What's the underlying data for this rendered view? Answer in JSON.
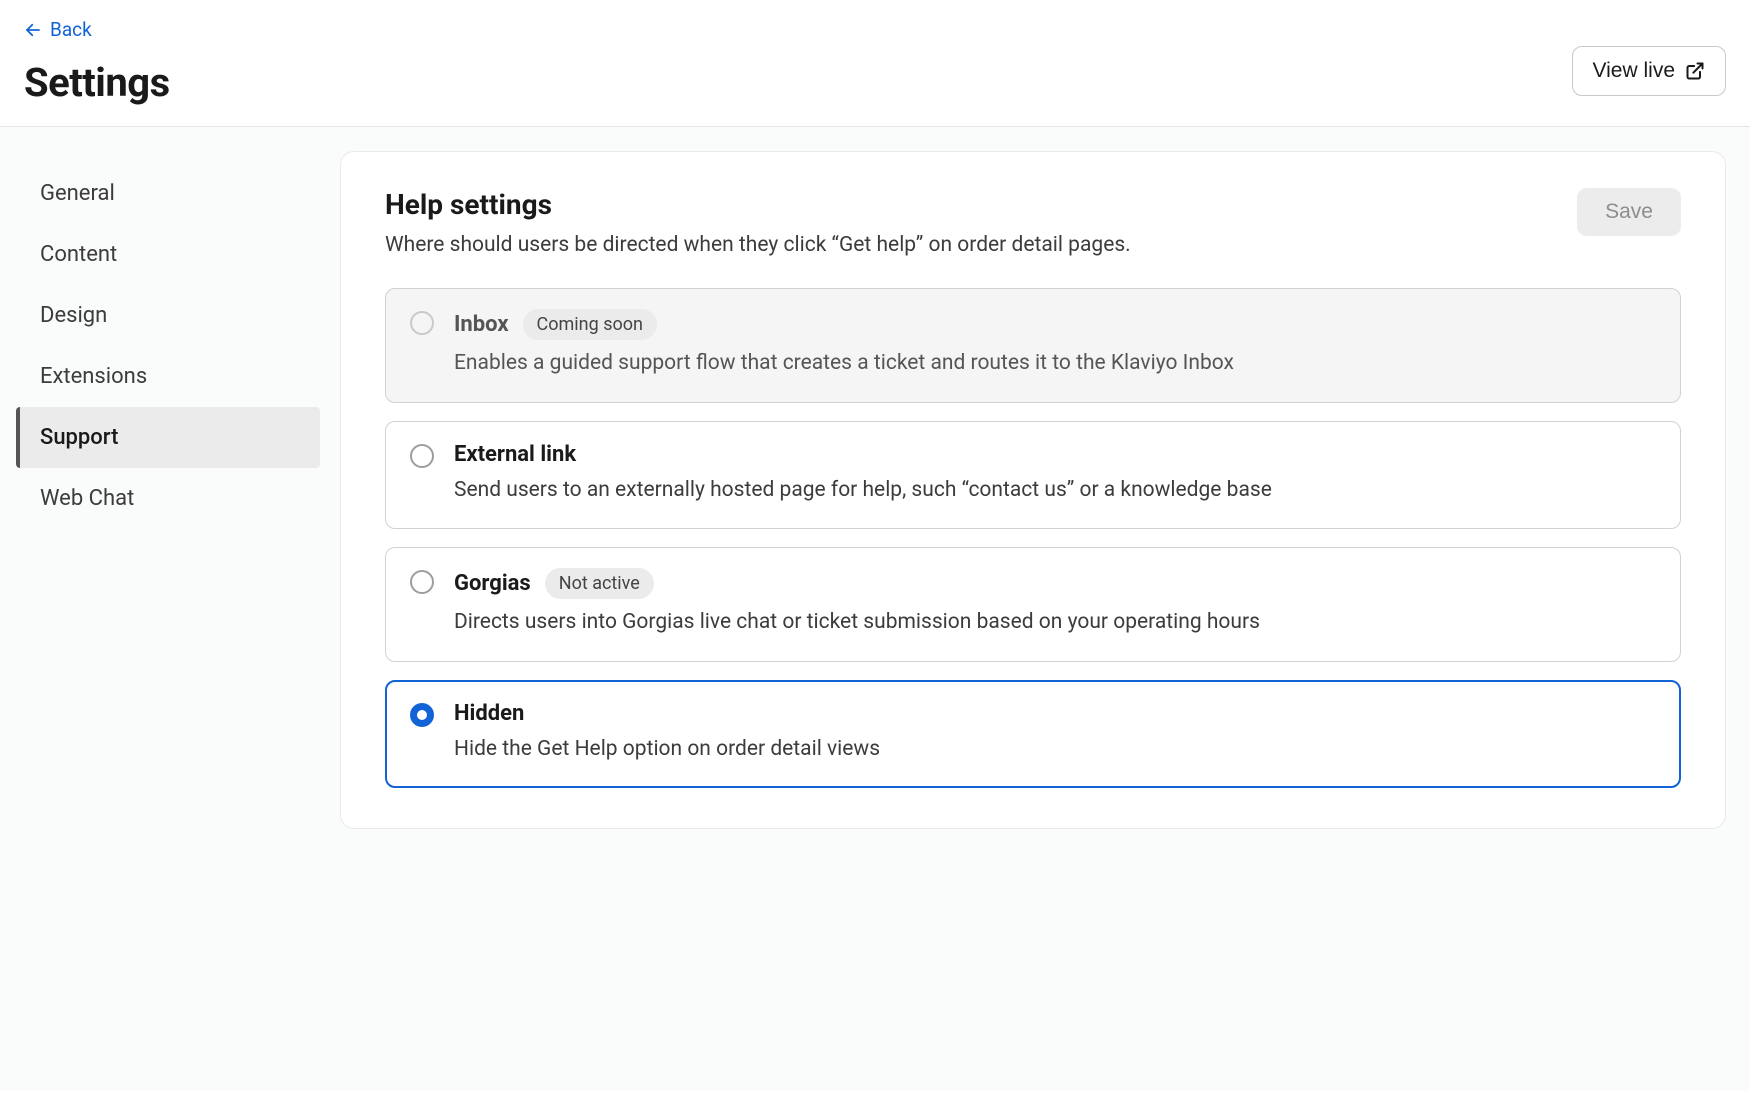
{
  "header": {
    "back_label": "Back",
    "page_title": "Settings",
    "view_live_label": "View live"
  },
  "sidebar": {
    "items": [
      {
        "label": "General",
        "active": false
      },
      {
        "label": "Content",
        "active": false
      },
      {
        "label": "Design",
        "active": false
      },
      {
        "label": "Extensions",
        "active": false
      },
      {
        "label": "Support",
        "active": true
      },
      {
        "label": "Web Chat",
        "active": false
      }
    ]
  },
  "main": {
    "section_title": "Help settings",
    "section_desc": "Where should users be directed when they click “Get help” on order detail pages.",
    "save_label": "Save",
    "options": [
      {
        "id": "inbox",
        "title": "Inbox",
        "badge": "Coming soon",
        "description": "Enables a guided support flow that creates a ticket and routes it to the Klaviyo Inbox",
        "disabled": true,
        "selected": false
      },
      {
        "id": "external",
        "title": "External link",
        "badge": null,
        "description": "Send users to an externally hosted page for help, such “contact us” or a knowledge base",
        "disabled": false,
        "selected": false
      },
      {
        "id": "gorgias",
        "title": "Gorgias",
        "badge": "Not active",
        "description": "Directs users into Gorgias live chat or ticket submission based on your operating hours",
        "disabled": false,
        "selected": false
      },
      {
        "id": "hidden",
        "title": "Hidden",
        "badge": null,
        "description": "Hide the Get Help option on order detail views",
        "disabled": false,
        "selected": true
      }
    ]
  }
}
